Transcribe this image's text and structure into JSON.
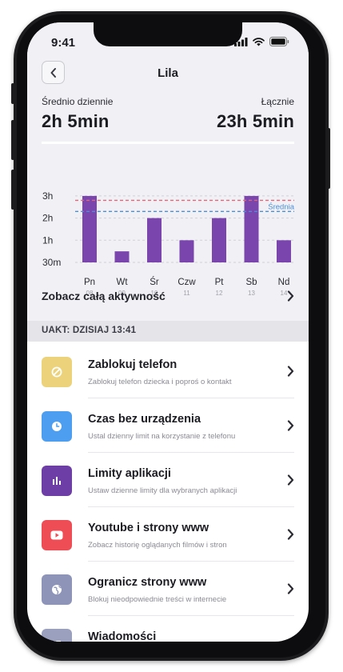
{
  "status_bar": {
    "time": "9:41"
  },
  "header": {
    "title": "Lila"
  },
  "summary": {
    "avg_label": "Średnio dziennie",
    "avg_value": "2h 5min",
    "total_label": "Łącznie",
    "total_value": "23h 5min"
  },
  "chart_data": {
    "type": "bar",
    "categories": [
      "Pn",
      "Wt",
      "Śr",
      "Czw",
      "Pt",
      "Sb",
      "Nd"
    ],
    "dates": [
      "08",
      "09",
      "10",
      "11",
      "12",
      "13",
      "14"
    ],
    "values": [
      3.0,
      0.5,
      2.0,
      1.0,
      2.0,
      3.0,
      1.0
    ],
    "y_unit": "hours",
    "ylim": [
      0,
      3.25
    ],
    "yticks": [
      {
        "value": 3,
        "label": "3h"
      },
      {
        "value": 2,
        "label": "2h"
      },
      {
        "value": 1,
        "label": "1h"
      },
      {
        "value": 0,
        "label": "30m"
      }
    ],
    "reference_lines": [
      {
        "value": 2.8,
        "style": "dashed",
        "color": "#e0667a"
      },
      {
        "value": 2.3,
        "style": "dashed",
        "color": "#4a8fd8",
        "label": "Średnia"
      }
    ],
    "bar_color": "#7a45ad",
    "grid": true
  },
  "see_all": {
    "label": "Zobacz całą aktywność"
  },
  "update_bar": {
    "text": "UAKT: DZISIAJ 13:41"
  },
  "menu": [
    {
      "title": "Zablokuj telefon",
      "subtitle": "Zablokuj telefon dziecka i poproś o kontakt",
      "icon": "block-icon",
      "color": "#ecd27a"
    },
    {
      "title": "Czas bez urządzenia",
      "subtitle": "Ustal dzienny limit na korzystanie z telefonu",
      "icon": "clock-icon",
      "color": "#4d9ef0"
    },
    {
      "title": "Limity aplikacji",
      "subtitle": "Ustaw dzienne limity dla wybranych aplikacji",
      "icon": "bar-chart-icon",
      "color": "#6d3fa6"
    },
    {
      "title": "Youtube i strony www",
      "subtitle": "Zobacz historię oglądanych filmów i stron",
      "icon": "play-icon",
      "color": "#ee4d56"
    },
    {
      "title": "Ogranicz strony www",
      "subtitle": "Blokuj nieodpowiednie treści w internecie",
      "icon": "globe-icon",
      "color": "#8e94b8"
    },
    {
      "title": "Wiadomości",
      "subtitle": "",
      "icon": "message-icon",
      "color": "#9aa0bd"
    }
  ]
}
